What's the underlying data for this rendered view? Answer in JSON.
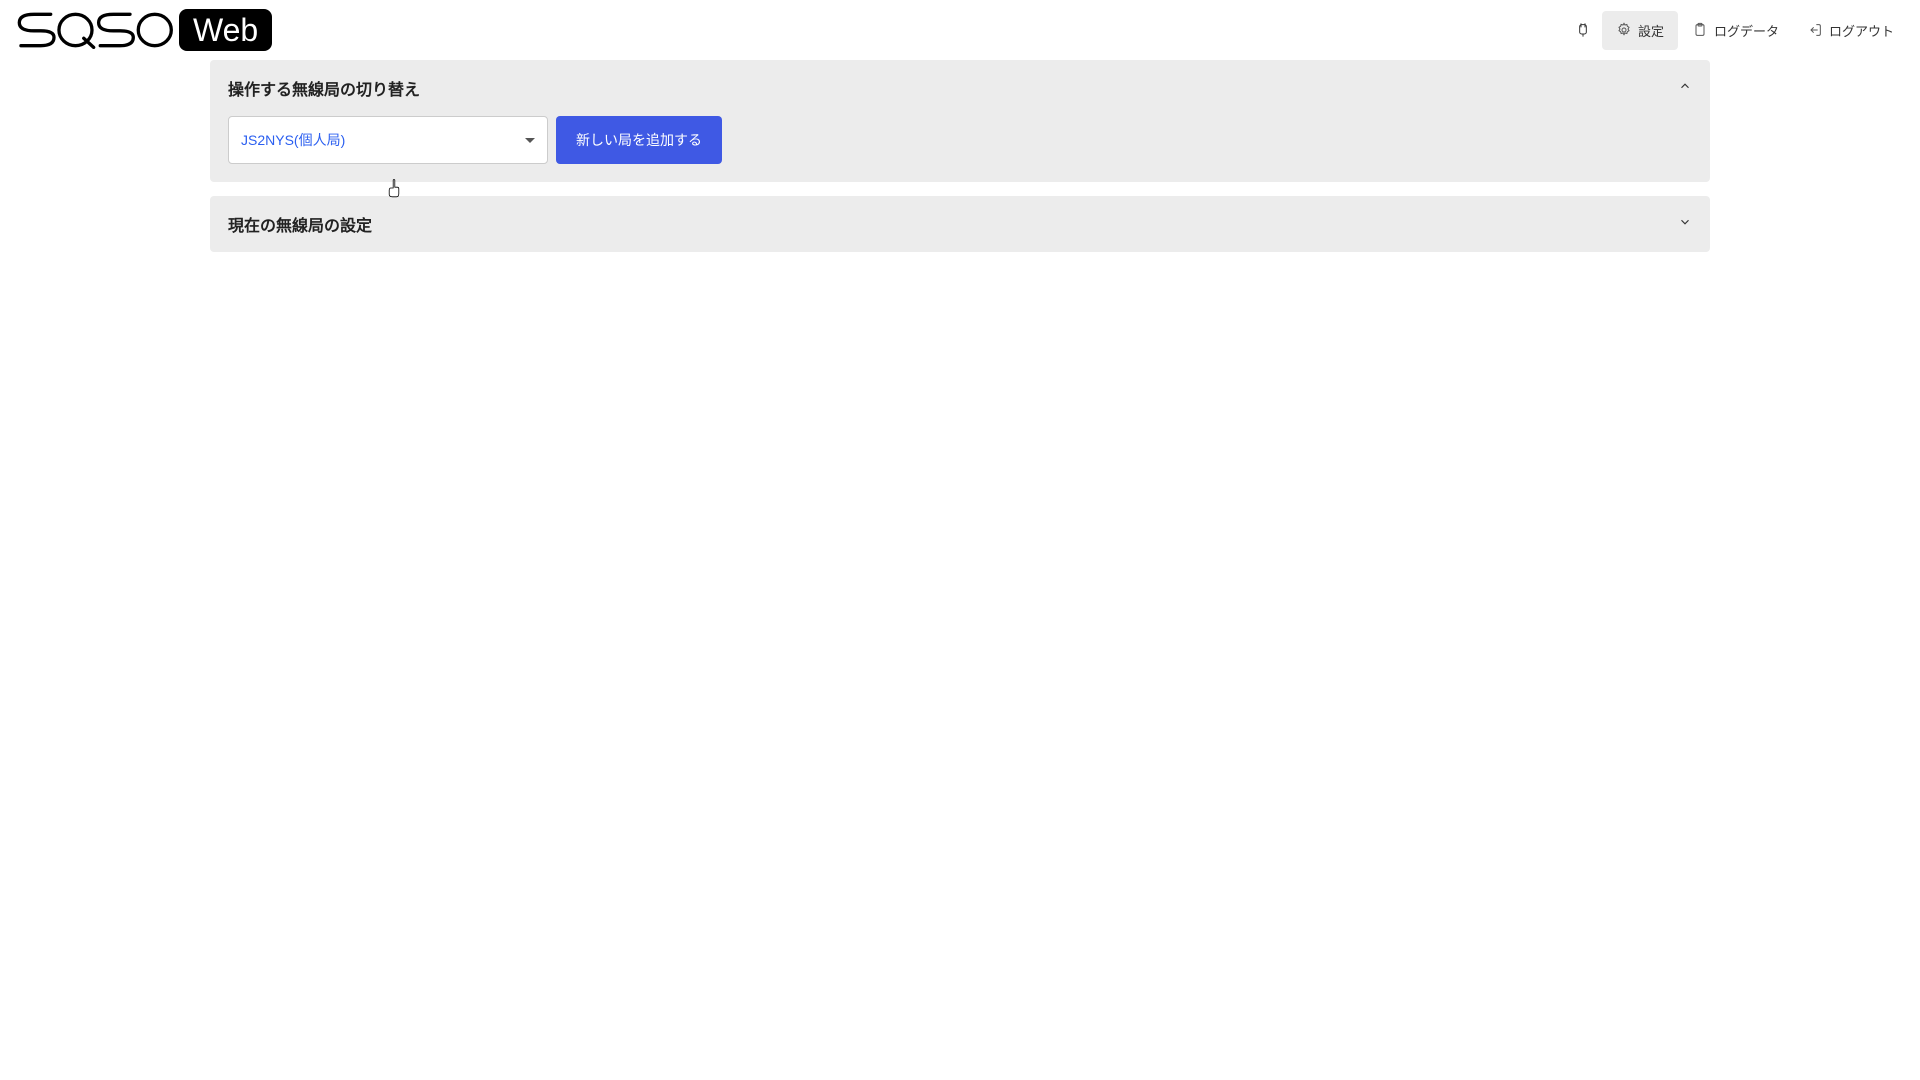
{
  "header": {
    "logo_text1": "SQSO",
    "logo_text2": "Web",
    "nav": {
      "settings": "設定",
      "logdata": "ログデータ",
      "logout": "ログアウト"
    }
  },
  "panel1": {
    "title": "操作する無線局の切り替え",
    "select_value": "JS2NYS(個人局)",
    "add_button": "新しい局を追加する"
  },
  "panel2": {
    "title": "現在の無線局の設定"
  }
}
